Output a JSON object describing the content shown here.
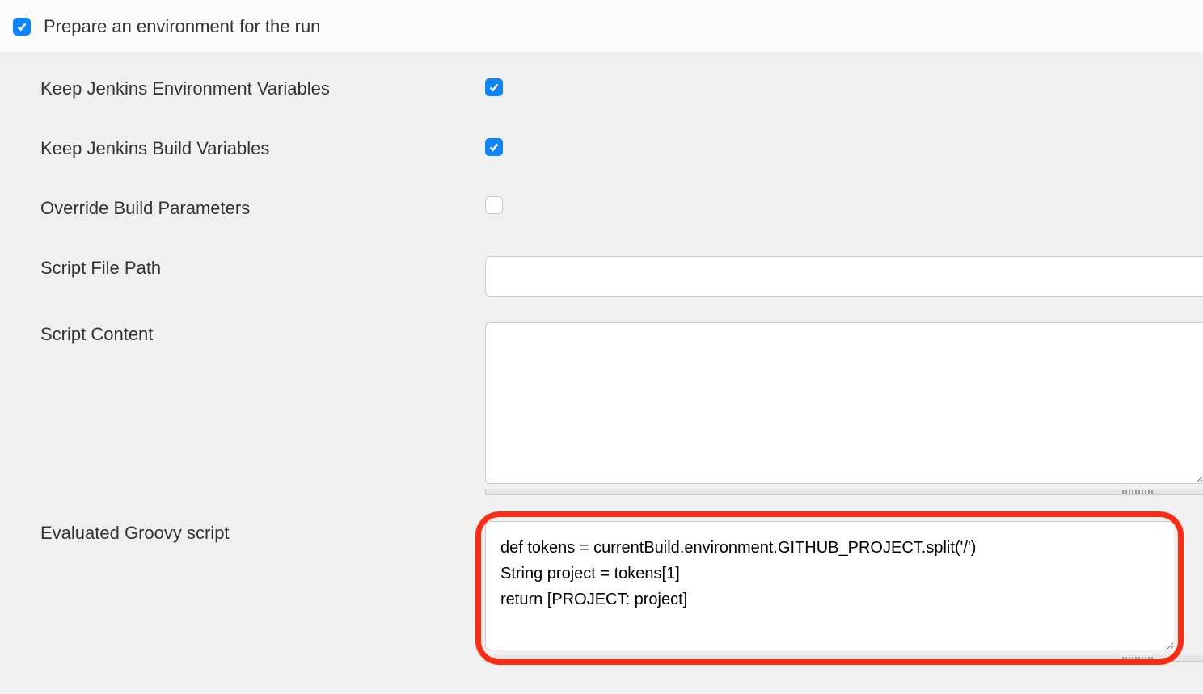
{
  "header": {
    "prepare_env_label": "Prepare an environment for the run",
    "prepare_env_checked": true
  },
  "rows": {
    "keep_env_vars": {
      "label": "Keep Jenkins Environment Variables",
      "checked": true
    },
    "keep_build_vars": {
      "label": "Keep Jenkins Build Variables",
      "checked": true
    },
    "override_params": {
      "label": "Override Build Parameters",
      "checked": false
    },
    "script_file_path": {
      "label": "Script File Path",
      "value": ""
    },
    "script_content": {
      "label": "Script Content",
      "value": ""
    },
    "groovy": {
      "label": "Evaluated Groovy script",
      "value": "def tokens = currentBuild.environment.GITHUB_PROJECT.split('/')\nString project = tokens[1]\nreturn [PROJECT: project]"
    }
  }
}
